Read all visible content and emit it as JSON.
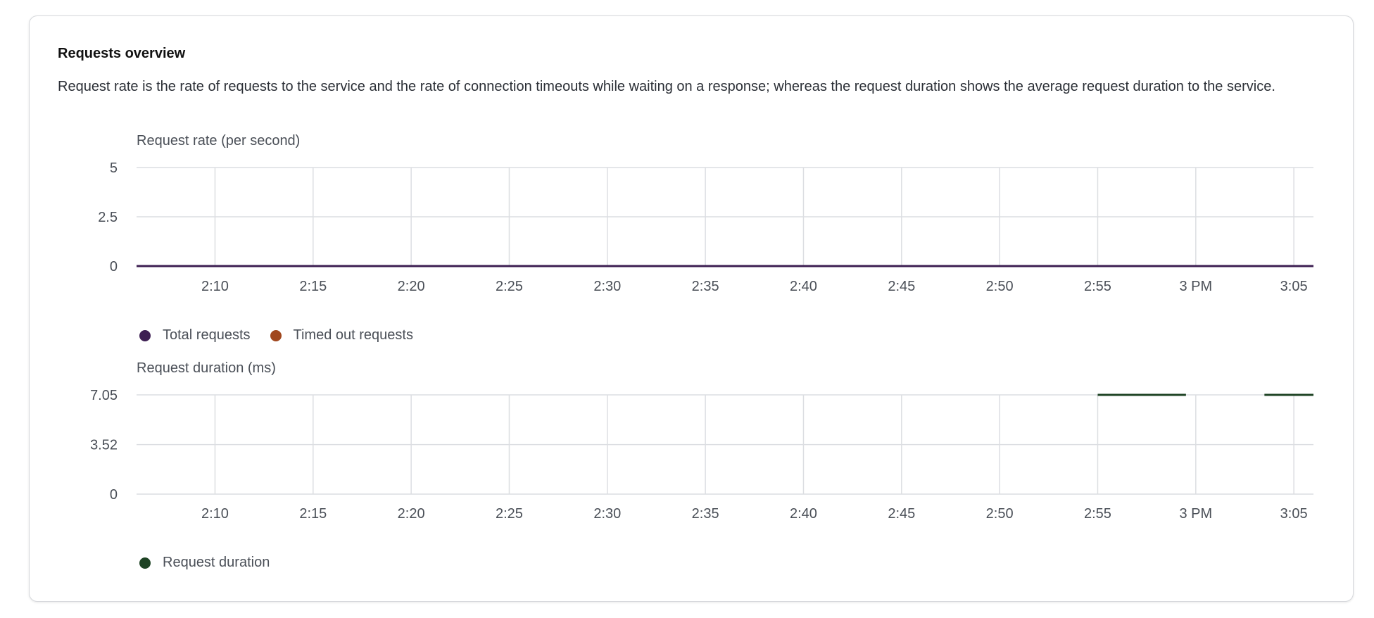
{
  "card": {
    "title": "Requests overview",
    "description": "Request rate is the rate of requests to the service and the rate of connection timeouts while waiting on a response; whereas the request duration shows the average request duration to the service."
  },
  "colors": {
    "total_requests": "#3d1f52",
    "timed_out_requests": "#a0471e",
    "request_duration": "#1e4324",
    "grid": "#dcdee2",
    "tick_text": "#4a4f57"
  },
  "chart_data": [
    {
      "type": "line",
      "title": "Request rate (per second)",
      "x": [
        "2:10",
        "2:15",
        "2:20",
        "2:25",
        "2:30",
        "2:35",
        "2:40",
        "2:45",
        "2:50",
        "2:55",
        "3 PM",
        "3:05"
      ],
      "xlim": [
        "2:06",
        "3:06"
      ],
      "ylim": [
        0,
        5
      ],
      "yticks": [
        "5",
        "2.5",
        "0"
      ],
      "grid": true,
      "legend_position": "bottom-left",
      "series": [
        {
          "name": "Total requests",
          "segments": [
            {
              "points": [
                [
                  "2:06",
                  0
                ],
                [
                  "3:06",
                  0
                ]
              ]
            }
          ]
        },
        {
          "name": "Timed out requests",
          "segments": []
        }
      ]
    },
    {
      "type": "line",
      "title": "Request duration (ms)",
      "x": [
        "2:10",
        "2:15",
        "2:20",
        "2:25",
        "2:30",
        "2:35",
        "2:40",
        "2:45",
        "2:50",
        "2:55",
        "3 PM",
        "3:05"
      ],
      "xlim": [
        "2:06",
        "3:06"
      ],
      "ylim": [
        0,
        7.05
      ],
      "yticks": [
        "7.05",
        "3.52",
        "0"
      ],
      "grid": true,
      "legend_position": "bottom-left",
      "series": [
        {
          "name": "Request duration",
          "segments": [
            {
              "points": [
                [
                  "2:55",
                  7.05
                ],
                [
                  "2:59.5",
                  7.05
                ]
              ]
            },
            {
              "points": [
                [
                  "3:03.5",
                  7.05
                ],
                [
                  "3:06",
                  7.05
                ]
              ]
            }
          ]
        }
      ]
    }
  ]
}
